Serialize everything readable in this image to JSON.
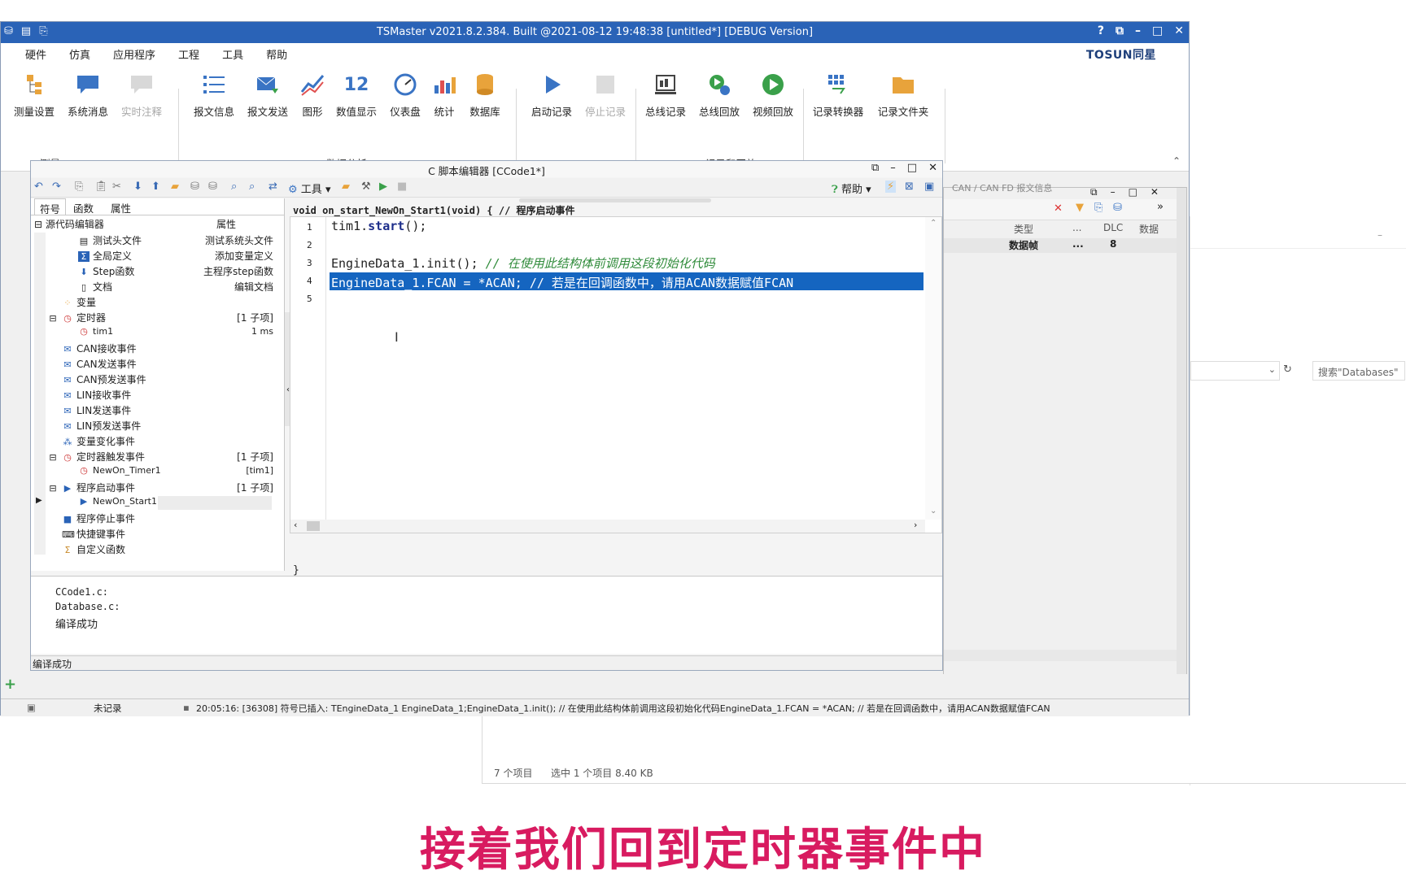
{
  "window": {
    "title": "TSMaster v2021.8.2.384. Built @2021-08-12 19:48:38 [untitled*] [DEBUG Version]",
    "brand": "TOSUN同星"
  },
  "menu": [
    "硬件",
    "仿真",
    "应用程序",
    "工程",
    "工具",
    "帮助"
  ],
  "ribbon": {
    "measure": {
      "group": "测量",
      "items": [
        "测量设置",
        "系统消息",
        "实时注释"
      ]
    },
    "analysis": {
      "group": "数据分析",
      "items": [
        "报文信息",
        "报文发送",
        "图形",
        "数值显示",
        "仪表盘",
        "统计",
        "数据库"
      ]
    },
    "record": {
      "group": "记录和回放",
      "items": [
        "启动记录",
        "停止记录",
        "总线记录",
        "总线回放",
        "视频回放",
        "记录转换器",
        "记录文件夹"
      ]
    },
    "number_icon": "12"
  },
  "editor": {
    "title": "C 脚本编辑器 [CCode1*]",
    "toolbar": {
      "tools": "工具",
      "help": "帮助"
    },
    "tabs": [
      "符号",
      "函数",
      "属性"
    ],
    "tree_header": {
      "name": "源代码编辑器",
      "prop": "属性"
    },
    "tree": [
      {
        "label": "测试头文件",
        "prop": "测试系统头文件",
        "icon": "file-icon"
      },
      {
        "label": "全局定义",
        "prop": "添加变量定义",
        "icon": "sigma-icon"
      },
      {
        "label": "Step函数",
        "prop": "主程序step函数",
        "icon": "arrow-down-icon"
      },
      {
        "label": "文档",
        "prop": "编辑文档",
        "icon": "book-icon"
      },
      {
        "label": "变量",
        "prop": "",
        "icon": "variable-icon"
      },
      {
        "label": "定时器",
        "prop": "[1 子项]",
        "icon": "clock-icon"
      },
      {
        "label": "tim1",
        "prop": "1 ms",
        "icon": "clock-icon"
      },
      {
        "label": "CAN接收事件",
        "prop": "",
        "icon": "envelope-icon"
      },
      {
        "label": "CAN发送事件",
        "prop": "",
        "icon": "send-icon"
      },
      {
        "label": "CAN预发送事件",
        "prop": "",
        "icon": "send-icon"
      },
      {
        "label": "LIN接收事件",
        "prop": "",
        "icon": "envelope-icon"
      },
      {
        "label": "LIN发送事件",
        "prop": "",
        "icon": "send-icon"
      },
      {
        "label": "LIN预发送事件",
        "prop": "",
        "icon": "send-icon"
      },
      {
        "label": "变量变化事件",
        "prop": "",
        "icon": "variable-icon"
      },
      {
        "label": "定时器触发事件",
        "prop": "[1 子项]",
        "icon": "timer-icon"
      },
      {
        "label": "NewOn_Timer1",
        "prop": "[tim1]",
        "icon": "timer-icon"
      },
      {
        "label": "程序启动事件",
        "prop": "[1 子项]",
        "icon": "play-icon"
      },
      {
        "label": "NewOn_Start1",
        "prop": "",
        "icon": "play-icon"
      },
      {
        "label": "程序停止事件",
        "prop": "",
        "icon": "stop-icon"
      },
      {
        "label": "快捷键事件",
        "prop": "",
        "icon": "keyboard-icon"
      },
      {
        "label": "自定义函数",
        "prop": "",
        "icon": "sigma-icon"
      }
    ],
    "func_header": "void on_start_NewOn_Start1(void) { // 程序启动事件",
    "lines": [
      "1",
      "2",
      "3",
      "4",
      "5"
    ],
    "code": {
      "l1_a": "tim1.",
      "l1_b": "start",
      "l1_c": "();",
      "l3_a": "EngineData_1.init(); ",
      "l3_b": "// 在使用此结构体前调用这段初始化代码",
      "l4": "EngineData_1.FCAN = *ACAN; // 若是在回调函数中，请用ACAN数据赋值FCAN"
    },
    "closing": "}",
    "messages": [
      "CCode1.c:",
      "Database.c:",
      "编译成功"
    ],
    "status": "编译成功"
  },
  "rpanel": {
    "title": "CAN / CAN FD 报文信息",
    "columns": [
      "类型",
      "...",
      "DLC",
      "数据"
    ],
    "row": [
      "数据帧",
      "...",
      "8"
    ]
  },
  "statusbar": {
    "record": "未记录",
    "log": "20:05:16: [36308] 符号已插入: TEngineData_1 EngineData_1;EngineData_1.init(); // 在使用此结构体前调用这段初始化代码EngineData_1.FCAN = *ACAN; // 若是在回调函数中，请用ACAN数据赋值FCAN"
  },
  "explorer": {
    "search_placeholder": "搜索\"Databases\"",
    "count": "7 个项目",
    "selected": "选中 1 个项目  8.40 KB"
  },
  "subtitle": "接着我们回到定时器事件中"
}
